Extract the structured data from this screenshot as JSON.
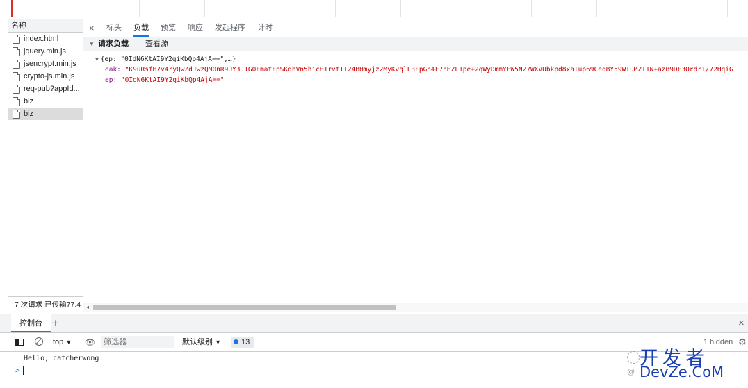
{
  "network": {
    "name_column_header": "名称",
    "files": [
      "index.html",
      "jquery.min.js",
      "jsencrypt.min.js",
      "crypto-js.min.js",
      "req-pub?appId...",
      "biz",
      "biz"
    ],
    "status": "7 次请求  已传输77.4"
  },
  "detail": {
    "close_glyph": "×",
    "tabs": [
      "标头",
      "负载",
      "预览",
      "响应",
      "发起程序",
      "计时"
    ],
    "active_tab": "负载",
    "section_title": "请求负载",
    "view_source": "查看源",
    "payload_summary": "{ep: \"0IdN6KtAI9Y2qiKbQp4AjA==\",…}",
    "eak_key": "eak:",
    "eak_value": "\"K9uRsfH7v4ryQwZdJwzQM0nR9UY3J1G0FmatFpSKdhVn5hicH1rvtTT24BHmyjz2MyKvqlL3FpGn4F7hHZL1pe+2qWyDmmYFW5N27WXVUbkpd8xaIup69CeqBY59WTuMZT1N+azB9DF3Ordr1/72HqiG",
    "ep_key": "ep:",
    "ep_value": "\"0IdN6KtAI9Y2qiKbQp4AjA==\""
  },
  "drawer": {
    "console_tab": "控制台",
    "add_glyph": "+",
    "close_glyph": "×"
  },
  "console": {
    "context": "top",
    "filter_placeholder": "筛选器",
    "level": "默认级别",
    "issues_count": "13",
    "hidden": "1 hidden",
    "log": "Hello, catcherwong",
    "prompt": ">"
  },
  "watermark": {
    "main": "开发者",
    "sub": "DevZe.CoM"
  },
  "colors": {
    "accent": "#1a73e8",
    "key": "#881280",
    "string": "#c80000",
    "watermark": "#1a3fb0"
  }
}
